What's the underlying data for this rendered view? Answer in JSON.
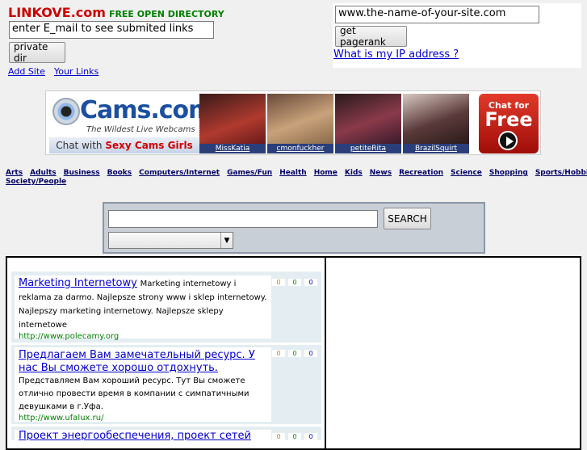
{
  "header": {
    "logo": "LINKOVE.com",
    "tagline": "FREE OPEN DIRECTORY",
    "email_input_value": "enter E_mail to see submited links",
    "private_dir_button": "private dir",
    "add_site_link": "Add Site",
    "your_links_link": "Your Links"
  },
  "pagerank": {
    "site_input_value": "www.the-name-of-your-site.com",
    "get_pagerank_button": "get pagerank",
    "ip_link": "What is my IP address ?"
  },
  "banner": {
    "logo_text": "Cams.com",
    "logo_sub": "The Wildest Live Webcams",
    "chat_text": "Chat with ",
    "chat_highlight": "Sexy Cams Girls",
    "thumbs": [
      {
        "caption": "MissKatia",
        "color": "#b03a2e"
      },
      {
        "caption": "cmonfuckher",
        "color": "#c8a27a"
      },
      {
        "caption": "petiteRita",
        "color": "#8a3a4a"
      },
      {
        "caption": "BrazilSquirt",
        "color": "#5a3a3a"
      }
    ],
    "cta_line1": "Chat for",
    "cta_line2": "Free"
  },
  "categories": [
    "Arts",
    "Adults",
    "Business",
    "Books",
    "Computers/Internet",
    "Games/Fun",
    "Health",
    "Home",
    "Kids",
    "News",
    "Recreation",
    "Science",
    "Shopping",
    "Sports/Hobbies",
    "Society/People"
  ],
  "search": {
    "query_value": "",
    "search_button": "SEARCH",
    "select_value": ""
  },
  "listings": [
    {
      "title": "Marketing Internetowy",
      "description": "Marketing internetowy i reklama za darmo. Najlepsze strony www i sklep internetowy. Najlepszy marketing internetowy. Najlepsze sklepy internetowe",
      "url": "http://www.polecamy.org",
      "counts": [
        "0",
        "0",
        "0"
      ]
    },
    {
      "title": "Предлагаем Вам замечательный ресурс. У нас Вы сможете хорошо отдохнуть.",
      "description": "Представляем Вам хороший ресурс. Тут Вы сможете отлично провести время в компании с симпатичными девушками в г.Уфа.",
      "url": "http://www.ufalux.ru/",
      "counts": [
        "0",
        "0",
        "0"
      ]
    },
    {
      "title": "Проект энергообеспечения, проект сетей",
      "description": "",
      "url": "",
      "counts": [
        "0",
        "0",
        "0"
      ]
    }
  ]
}
